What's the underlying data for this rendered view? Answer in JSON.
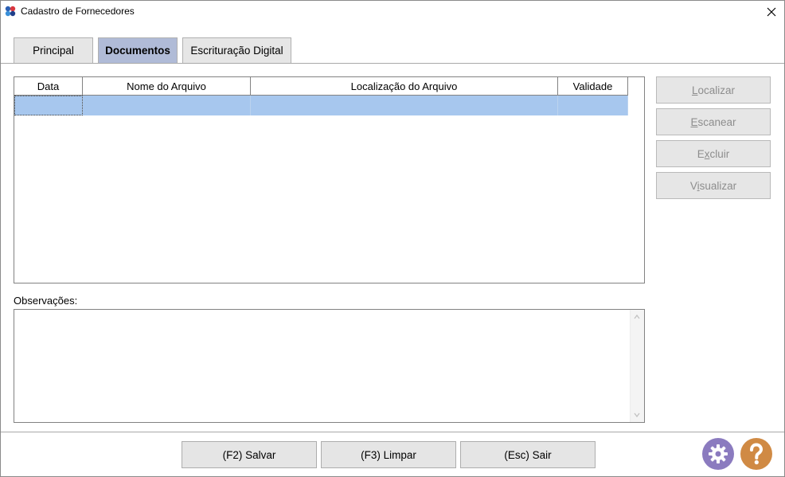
{
  "window": {
    "title": "Cadastro de Fornecedores",
    "close_icon": "close-icon"
  },
  "tabs": [
    {
      "label": "Principal",
      "active": false
    },
    {
      "label": "Documentos",
      "active": true
    },
    {
      "label": "Escrituração Digital",
      "active": false
    }
  ],
  "grid": {
    "columns": [
      "Data",
      "Nome do Arquivo",
      "Localização do Arquivo",
      "Validade"
    ],
    "rows": [
      [
        "",
        "",
        "",
        ""
      ]
    ],
    "selected_row_color": "#a7c7ee"
  },
  "side_buttons": [
    {
      "label_pre": "",
      "accel": "L",
      "label_post": "ocalizar",
      "enabled": false
    },
    {
      "label_pre": "",
      "accel": "E",
      "label_post": "scanear",
      "enabled": false
    },
    {
      "label_pre": "E",
      "accel": "x",
      "label_post": "cluir",
      "enabled": false
    },
    {
      "label_pre": "V",
      "accel": "i",
      "label_post": "sualizar",
      "enabled": false
    }
  ],
  "observacoes": {
    "label": "Observações:",
    "value": ""
  },
  "bottom_buttons": {
    "save": "(F2) Salvar",
    "clear": "(F3) Limpar",
    "exit": "(Esc) Sair"
  },
  "icons": {
    "settings": "gear-icon",
    "help": "help-icon"
  },
  "colors": {
    "active_tab": "#b0bbd7",
    "settings_icon": "#8b7bbf",
    "help_icon": "#d08a44"
  }
}
